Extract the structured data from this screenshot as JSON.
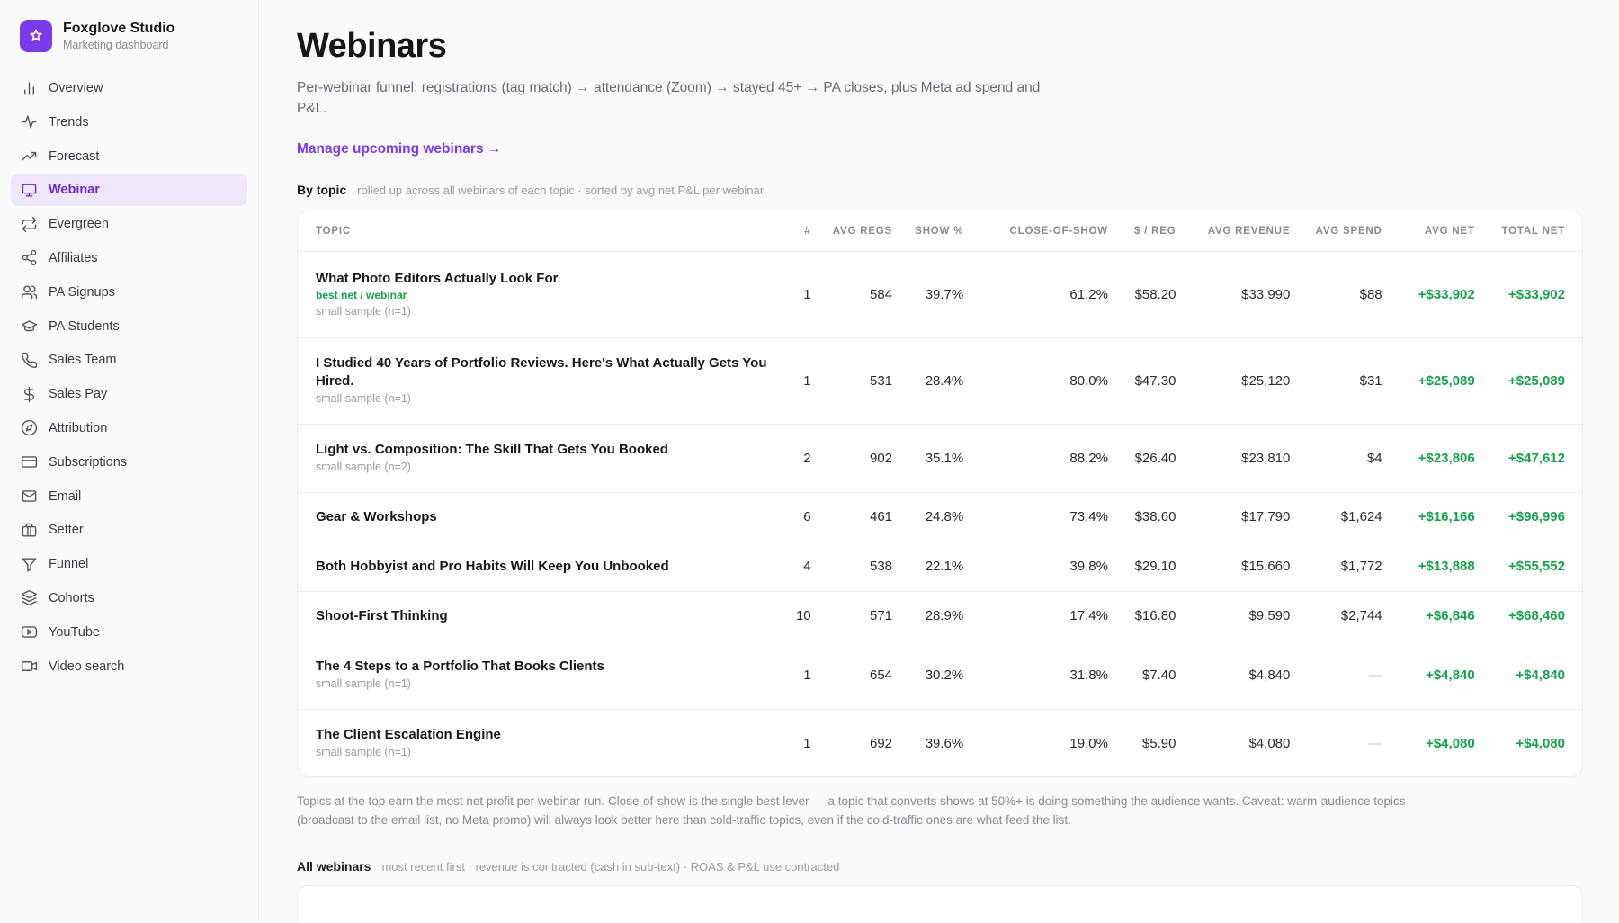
{
  "brand": {
    "name": "Foxglove Studio",
    "subtitle": "Marketing dashboard"
  },
  "nav": [
    {
      "label": "Overview",
      "icon": "bar-chart-icon"
    },
    {
      "label": "Trends",
      "icon": "pulse-icon"
    },
    {
      "label": "Forecast",
      "icon": "trending-up-icon"
    },
    {
      "label": "Webinar",
      "icon": "monitor-icon",
      "active": true
    },
    {
      "label": "Evergreen",
      "icon": "repeat-icon"
    },
    {
      "label": "Affiliates",
      "icon": "share-icon"
    },
    {
      "label": "PA Signups",
      "icon": "users-icon"
    },
    {
      "label": "PA Students",
      "icon": "graduation-cap-icon"
    },
    {
      "label": "Sales Team",
      "icon": "phone-icon"
    },
    {
      "label": "Sales Pay",
      "icon": "dollar-icon"
    },
    {
      "label": "Attribution",
      "icon": "compass-icon"
    },
    {
      "label": "Subscriptions",
      "icon": "credit-card-icon"
    },
    {
      "label": "Email",
      "icon": "mail-icon"
    },
    {
      "label": "Setter",
      "icon": "briefcase-icon"
    },
    {
      "label": "Funnel",
      "icon": "filter-icon"
    },
    {
      "label": "Cohorts",
      "icon": "layers-icon"
    },
    {
      "label": "YouTube",
      "icon": "youtube-icon"
    },
    {
      "label": "Video search",
      "icon": "video-icon"
    }
  ],
  "page": {
    "title": "Webinars",
    "description": "Per-webinar funnel: registrations (tag match) → attendance (Zoom) → stayed 45+ → PA closes, plus Meta ad spend and P&L.",
    "manage_link": "Manage upcoming webinars →"
  },
  "by_topic": {
    "heading": "By topic",
    "subheading": "rolled up across all webinars of each topic · sorted by avg net P&L per webinar",
    "columns": [
      "Topic",
      "#",
      "Avg Regs",
      "Show %",
      "Close-of-show",
      "$ / Reg",
      "Avg Revenue",
      "Avg Spend",
      "Avg Net",
      "Total Net"
    ],
    "rows": [
      {
        "topic": "What Photo Editors Actually Look For",
        "badge": "best net / webinar",
        "note": "small sample (n=1)",
        "count": "1",
        "avg_regs": "584",
        "show_pct": "39.7%",
        "close_of_show": "61.2%",
        "per_reg": "$58.20",
        "avg_revenue": "$33,990",
        "avg_spend": "$88",
        "avg_net": "+$33,902",
        "total_net": "+$33,902"
      },
      {
        "topic": "I Studied 40 Years of Portfolio Reviews. Here's What Actually Gets You Hired.",
        "badge": "",
        "note": "small sample (n=1)",
        "count": "1",
        "avg_regs": "531",
        "show_pct": "28.4%",
        "close_of_show": "80.0%",
        "per_reg": "$47.30",
        "avg_revenue": "$25,120",
        "avg_spend": "$31",
        "avg_net": "+$25,089",
        "total_net": "+$25,089"
      },
      {
        "topic": "Light vs. Composition: The Skill That Gets You Booked",
        "badge": "",
        "note": "small sample (n=2)",
        "count": "2",
        "avg_regs": "902",
        "show_pct": "35.1%",
        "close_of_show": "88.2%",
        "per_reg": "$26.40",
        "avg_revenue": "$23,810",
        "avg_spend": "$4",
        "avg_net": "+$23,806",
        "total_net": "+$47,612"
      },
      {
        "topic": "Gear & Workshops",
        "badge": "",
        "note": "",
        "count": "6",
        "avg_regs": "461",
        "show_pct": "24.8%",
        "close_of_show": "73.4%",
        "per_reg": "$38.60",
        "avg_revenue": "$17,790",
        "avg_spend": "$1,624",
        "avg_net": "+$16,166",
        "total_net": "+$96,996"
      },
      {
        "topic": "Both Hobbyist and Pro Habits Will Keep You Unbooked",
        "badge": "",
        "note": "",
        "count": "4",
        "avg_regs": "538",
        "show_pct": "22.1%",
        "close_of_show": "39.8%",
        "per_reg": "$29.10",
        "avg_revenue": "$15,660",
        "avg_spend": "$1,772",
        "avg_net": "+$13,888",
        "total_net": "+$55,552"
      },
      {
        "topic": "Shoot-First Thinking",
        "badge": "",
        "note": "",
        "count": "10",
        "avg_regs": "571",
        "show_pct": "28.9%",
        "close_of_show": "17.4%",
        "per_reg": "$16.80",
        "avg_revenue": "$9,590",
        "avg_spend": "$2,744",
        "avg_net": "+$6,846",
        "total_net": "+$68,460"
      },
      {
        "topic": "The 4 Steps to a Portfolio That Books Clients",
        "badge": "",
        "note": "small sample (n=1)",
        "count": "1",
        "avg_regs": "654",
        "show_pct": "30.2%",
        "close_of_show": "31.8%",
        "per_reg": "$7.40",
        "avg_revenue": "$4,840",
        "avg_spend": "—",
        "avg_net": "+$4,840",
        "total_net": "+$4,840"
      },
      {
        "topic": "The Client Escalation Engine",
        "badge": "",
        "note": "small sample (n=1)",
        "count": "1",
        "avg_regs": "692",
        "show_pct": "39.6%",
        "close_of_show": "19.0%",
        "per_reg": "$5.90",
        "avg_revenue": "$4,080",
        "avg_spend": "—",
        "avg_net": "+$4,080",
        "total_net": "+$4,080"
      }
    ],
    "footnote": "Topics at the top earn the most net profit per webinar run. Close-of-show is the single best lever — a topic that converts shows at 50%+ is doing something the audience wants. Caveat: warm-audience topics (broadcast to the email list, no Meta promo) will always look better here than cold-traffic topics, even if the cold-traffic ones are what feed the list."
  },
  "all_webinars": {
    "heading": "All webinars",
    "subheading": "most recent first · revenue is contracted (cash in sub-text) · ROAS & P&L use contracted"
  },
  "colors": {
    "accent": "#7c3aed",
    "positive": "#16a34a",
    "active_bg": "#efe8fc"
  }
}
